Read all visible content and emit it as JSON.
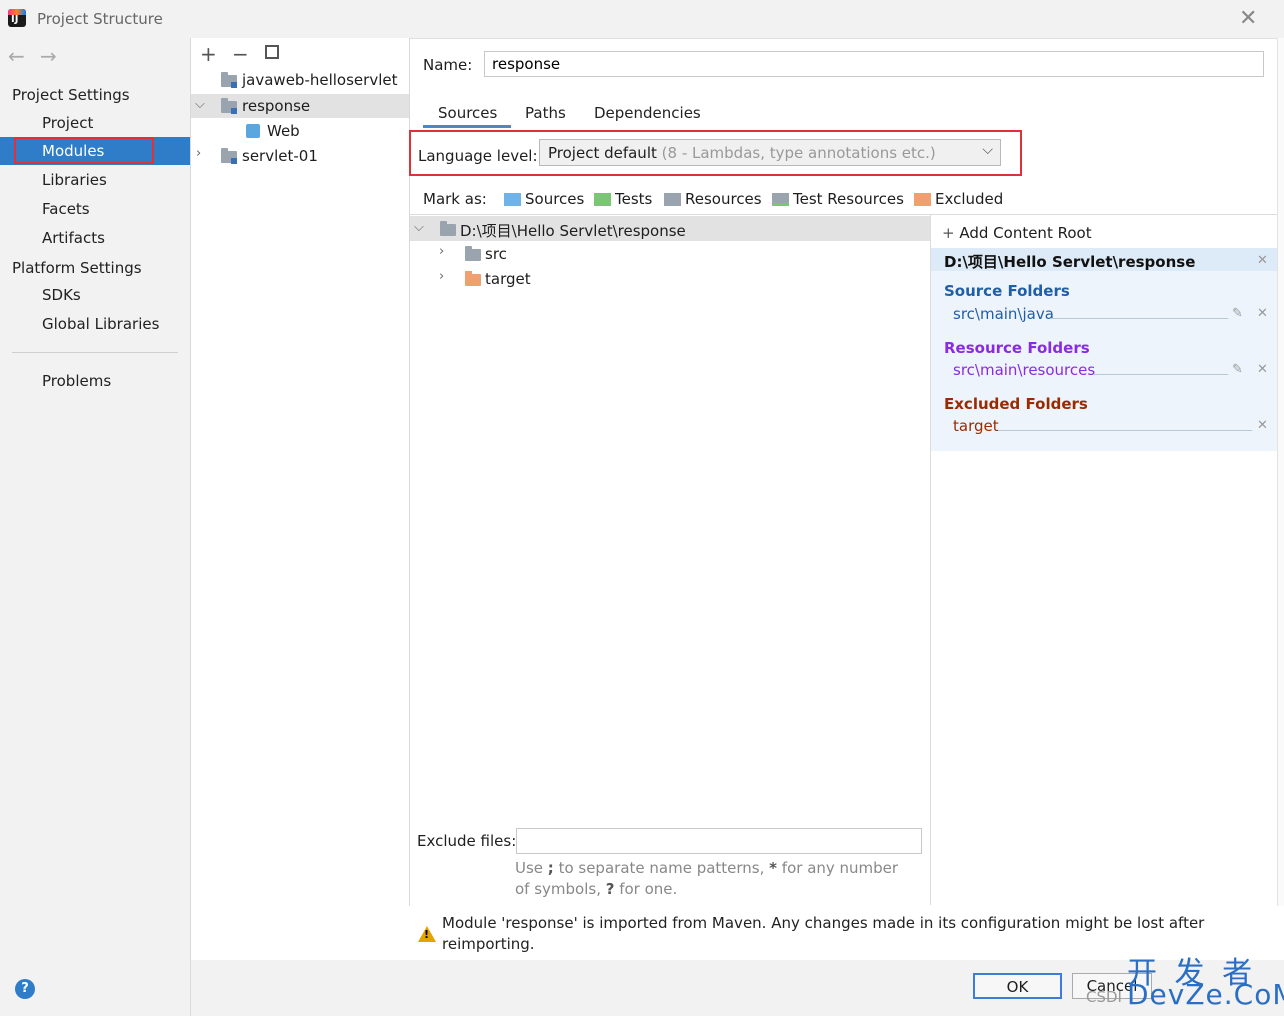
{
  "window": {
    "title": "Project Structure"
  },
  "left_nav": {
    "section_project_settings": "Project Settings",
    "project_items": [
      "Project",
      "Modules",
      "Libraries",
      "Facets",
      "Artifacts"
    ],
    "section_platform_settings": "Platform Settings",
    "platform_items": [
      "SDKs",
      "Global Libraries"
    ],
    "problems": "Problems",
    "selected": "Modules"
  },
  "module_tree": {
    "items": [
      {
        "label": "javaweb-helloservlet"
      },
      {
        "label": "response",
        "expanded": true,
        "selected": true
      },
      {
        "label": "Web"
      },
      {
        "label": "servlet-01"
      }
    ]
  },
  "module": {
    "name_label": "Name:",
    "name_value": "response",
    "tabs": [
      "Sources",
      "Paths",
      "Dependencies"
    ],
    "active_tab": "Sources",
    "language_level_label": "Language level:",
    "language_level_value": "Project default",
    "language_level_hint": "(8 - Lambdas, type annotations etc.)",
    "mark_as_label": "Mark as:",
    "mark_as": [
      "Sources",
      "Tests",
      "Resources",
      "Test Resources",
      "Excluded"
    ]
  },
  "content_tree": {
    "root": "D:\\项目\\Hello Servlet\\response",
    "children": [
      "src",
      "target"
    ]
  },
  "content_root_panel": {
    "add_content_root": "Add Content Root",
    "root_path": "D:\\项目\\Hello Servlet\\response",
    "source_folders_title": "Source Folders",
    "source_folder": "src\\main\\java",
    "resource_folders_title": "Resource Folders",
    "resource_folder": "src\\main\\resources",
    "excluded_folders_title": "Excluded Folders",
    "excluded_folder": "target"
  },
  "exclude_files": {
    "label": "Exclude files:",
    "value": "",
    "hint_1": "Use ",
    "hint_semicolon": ";",
    "hint_2": " to separate name patterns, ",
    "hint_star": "*",
    "hint_3": " for any number of symbols, ",
    "hint_q": "?",
    "hint_4": " for one."
  },
  "warning": {
    "text": "Module 'response' is imported from Maven. Any changes made in its configuration might be lost after reimporting."
  },
  "buttons": {
    "ok": "OK",
    "cancel": "Cancel"
  },
  "watermark": {
    "line1": "开 发 者",
    "line2": "DevZe.CoM",
    "csdn": "CSDI"
  },
  "colors": {
    "selection_blue": "#2f7dc9",
    "highlight_red": "#e0303a",
    "source_blue": "#1f5fa8",
    "resource_purple": "#8a2be2",
    "excluded_brown": "#9a2b00"
  }
}
